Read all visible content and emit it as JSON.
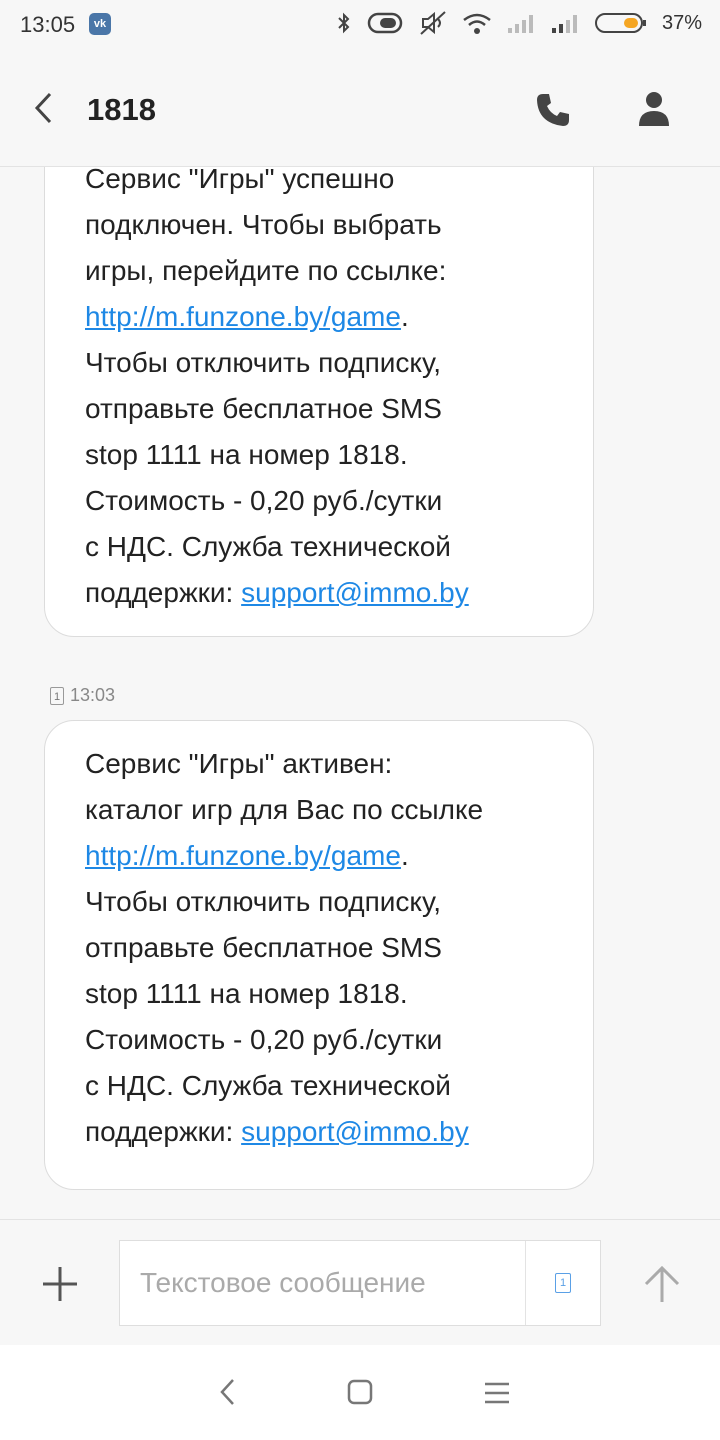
{
  "status_bar": {
    "time": "13:05",
    "battery_percent": "37%",
    "icons": [
      "vk-icon",
      "bluetooth-icon",
      "vibrate-icon",
      "mute-icon",
      "wifi-icon",
      "signal-icon",
      "signal-icon",
      "battery-icon"
    ]
  },
  "header": {
    "title": "1818",
    "icons": [
      "back-arrow-icon",
      "phone-icon",
      "contact-icon"
    ]
  },
  "messages": [
    {
      "lines": [
        {
          "text": "Сервис \"Игры\" успешно"
        },
        {
          "text": "подключен. Чтобы выбрать"
        },
        {
          "text": "игры, перейдите по ссылке:"
        },
        {
          "link": "http://m.funzone.by/game",
          "suffix": "."
        },
        {
          "text": "Чтобы отключить подписку,"
        },
        {
          "text": "отправьте бесплатное SMS"
        },
        {
          "text": "stop 1111 на номер 1818."
        },
        {
          "text": "Стоимость - 0,20 руб./сутки"
        },
        {
          "text": "с НДС. Служба технической"
        },
        {
          "prefix": "поддержки: ",
          "link": "support@immo.by"
        }
      ]
    },
    {
      "sim": "1",
      "time": "13:03",
      "lines": [
        {
          "text": "Сервис \"Игры\" активен:"
        },
        {
          "text": "каталог игр для Вас по ссылке"
        },
        {
          "link": "http://m.funzone.by/game",
          "suffix": "."
        },
        {
          "text": "Чтобы отключить подписку,"
        },
        {
          "text": "отправьте бесплатное SMS"
        },
        {
          "text": "stop 1111 на номер 1818."
        },
        {
          "text": "Стоимость - 0,20 руб./сутки"
        },
        {
          "text": "с НДС. Служба технической"
        },
        {
          "prefix": "поддержки: ",
          "link": "support@immo.by"
        }
      ]
    }
  ],
  "compose": {
    "placeholder": "Текстовое сообщение",
    "value": "",
    "sim": "1",
    "icons": [
      "plus-icon",
      "sim-card-icon",
      "send-arrow-icon"
    ]
  },
  "nav_bar": {
    "icons": [
      "nav-back-icon",
      "nav-home-icon",
      "nav-menu-icon"
    ]
  },
  "colors": {
    "background": "#f7f7f7",
    "bubble": "#ffffff",
    "link": "#1e88e5",
    "battery_fill": "#f5a623"
  }
}
